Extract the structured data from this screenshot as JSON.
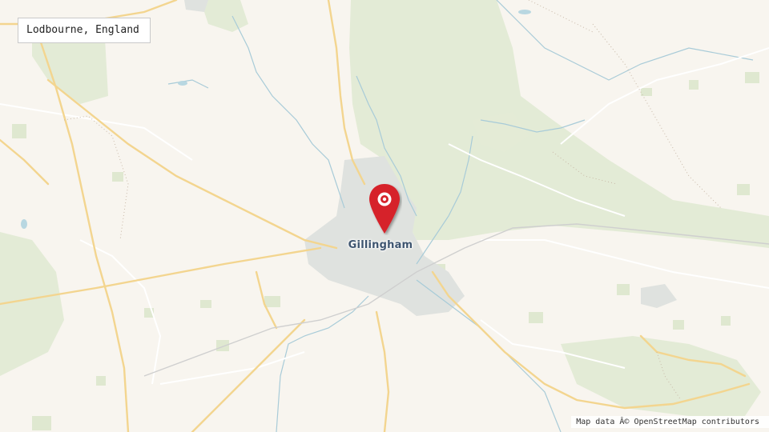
{
  "location_label": "Lodbourne, England",
  "place_label": "Gillingham",
  "attribution": "Map data Â© OpenStreetMap contributors",
  "colors": {
    "background": "#f8f5ef",
    "woodland": "#e3ebd6",
    "road": "#f4dca0",
    "water": "#9cc6d6",
    "urban": "#dde3e6",
    "marker": "#d6232b"
  },
  "icons": {
    "marker": "map-pin-icon"
  }
}
